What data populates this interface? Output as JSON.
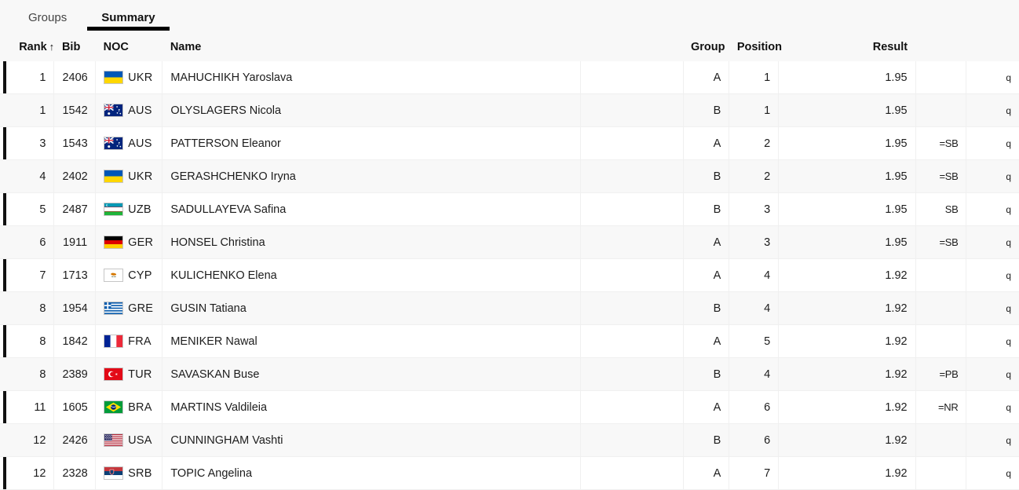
{
  "tabs": [
    {
      "label": "Groups",
      "active": false
    },
    {
      "label": "Summary",
      "active": true
    }
  ],
  "table": {
    "columns": {
      "rank": "Rank",
      "rank_sort_icon": "↑",
      "bib": "Bib",
      "noc": "NOC",
      "name": "Name",
      "blank": "",
      "group": "Group",
      "position": "Position",
      "result": "Result",
      "badge": "",
      "qual": ""
    },
    "rows": [
      {
        "rank": "1",
        "bib": "2406",
        "noc": "UKR",
        "flag": "flag-ukr",
        "name": "MAHUCHIKH Yaroslava",
        "group": "A",
        "position": "1",
        "result": "1.95",
        "badge": "",
        "qual": "q"
      },
      {
        "rank": "1",
        "bib": "1542",
        "noc": "AUS",
        "flag": "flag-aus",
        "name": "OLYSLAGERS Nicola",
        "group": "B",
        "position": "1",
        "result": "1.95",
        "badge": "",
        "qual": "q"
      },
      {
        "rank": "3",
        "bib": "1543",
        "noc": "AUS",
        "flag": "flag-aus",
        "name": "PATTERSON Eleanor",
        "group": "A",
        "position": "2",
        "result": "1.95",
        "badge": "=SB",
        "qual": "q"
      },
      {
        "rank": "4",
        "bib": "2402",
        "noc": "UKR",
        "flag": "flag-ukr",
        "name": "GERASHCHENKO Iryna",
        "group": "B",
        "position": "2",
        "result": "1.95",
        "badge": "=SB",
        "qual": "q"
      },
      {
        "rank": "5",
        "bib": "2487",
        "noc": "UZB",
        "flag": "flag-uzb",
        "name": "SADULLAYEVA Safina",
        "group": "B",
        "position": "3",
        "result": "1.95",
        "badge": "SB",
        "qual": "q"
      },
      {
        "rank": "6",
        "bib": "1911",
        "noc": "GER",
        "flag": "flag-ger",
        "name": "HONSEL Christina",
        "group": "A",
        "position": "3",
        "result": "1.95",
        "badge": "=SB",
        "qual": "q"
      },
      {
        "rank": "7",
        "bib": "1713",
        "noc": "CYP",
        "flag": "flag-cyp",
        "name": "KULICHENKO Elena",
        "group": "A",
        "position": "4",
        "result": "1.92",
        "badge": "",
        "qual": "q"
      },
      {
        "rank": "8",
        "bib": "1954",
        "noc": "GRE",
        "flag": "flag-gre",
        "name": "GUSIN Tatiana",
        "group": "B",
        "position": "4",
        "result": "1.92",
        "badge": "",
        "qual": "q"
      },
      {
        "rank": "8",
        "bib": "1842",
        "noc": "FRA",
        "flag": "flag-fra",
        "name": "MENIKER Nawal",
        "group": "A",
        "position": "5",
        "result": "1.92",
        "badge": "",
        "qual": "q"
      },
      {
        "rank": "8",
        "bib": "2389",
        "noc": "TUR",
        "flag": "flag-tur",
        "name": "SAVASKAN Buse",
        "group": "B",
        "position": "4",
        "result": "1.92",
        "badge": "=PB",
        "qual": "q"
      },
      {
        "rank": "11",
        "bib": "1605",
        "noc": "BRA",
        "flag": "flag-bra",
        "name": "MARTINS Valdileia",
        "group": "A",
        "position": "6",
        "result": "1.92",
        "badge": "=NR",
        "qual": "q"
      },
      {
        "rank": "12",
        "bib": "2426",
        "noc": "USA",
        "flag": "flag-usa",
        "name": "CUNNINGHAM Vashti",
        "group": "B",
        "position": "6",
        "result": "1.92",
        "badge": "",
        "qual": "q"
      },
      {
        "rank": "12",
        "bib": "2328",
        "noc": "SRB",
        "flag": "flag-srb",
        "name": "TOPIC Angelina",
        "group": "A",
        "position": "7",
        "result": "1.92",
        "badge": "",
        "qual": "q"
      }
    ]
  },
  "colors": {
    "tabbar_bg": "#f8f8f8",
    "header_bg": "#f8f8f8",
    "row_alt_bg": "#f8f8f8",
    "marker": "#111111",
    "text": "#1c1c1c",
    "active_tab_underline": "#000000"
  }
}
